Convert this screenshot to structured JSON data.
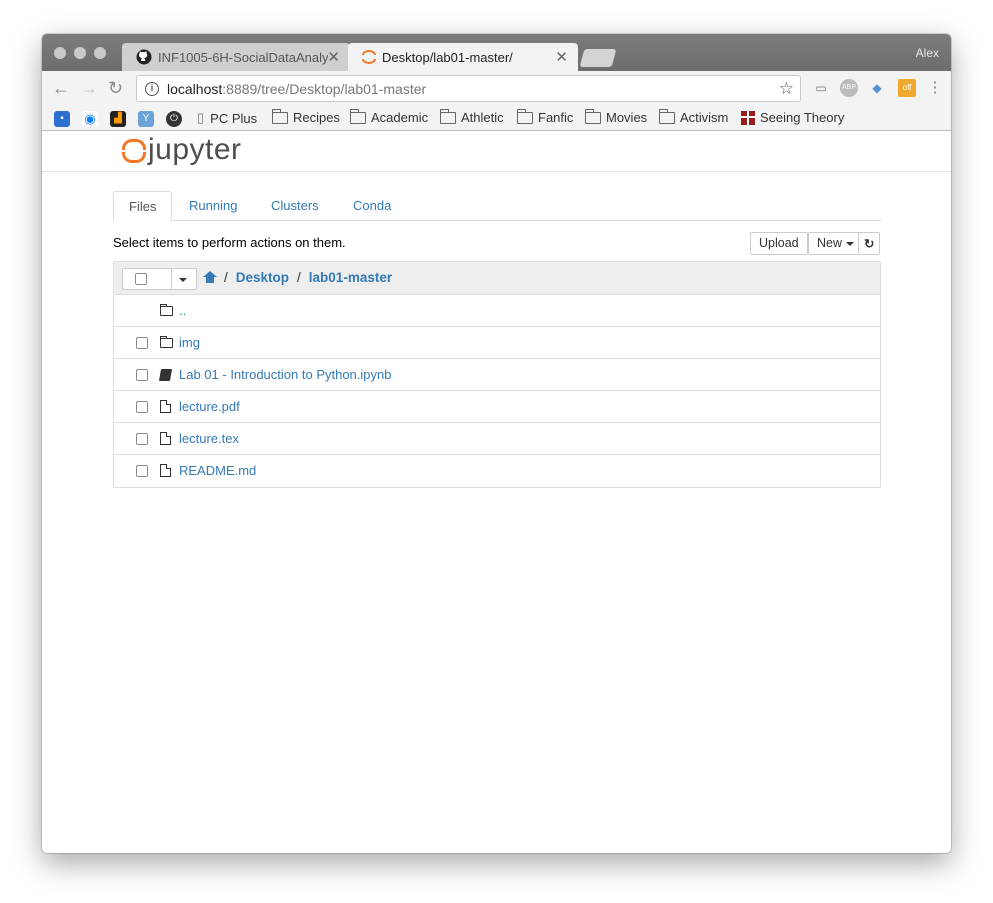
{
  "browser": {
    "tabs": [
      {
        "label": "INF1005-6H-SocialDataAnalyt",
        "active": false
      },
      {
        "label": "Desktop/lab01-master/",
        "active": true
      }
    ],
    "user": "Alex",
    "url_host": "localhost",
    "url_path": ":8889/tree/Desktop/lab01-master",
    "bookmarks": [
      "PC Plus",
      "Recipes",
      "Academic",
      "Athletic",
      "Fanfic",
      "Movies",
      "Activism",
      "Seeing Theory"
    ]
  },
  "jupyter": {
    "logo_text": "jupyter",
    "tabs": [
      "Files",
      "Running",
      "Clusters",
      "Conda"
    ],
    "hint": "Select items to perform actions on them.",
    "upload_label": "Upload",
    "new_label": "New",
    "breadcrumb": [
      "Desktop",
      "lab01-master"
    ],
    "files": [
      {
        "name": "..",
        "type": "folder",
        "checkbox": false
      },
      {
        "name": "img",
        "type": "folder",
        "checkbox": true
      },
      {
        "name": "Lab 01 - Introduction to Python.ipynb",
        "type": "notebook",
        "checkbox": true
      },
      {
        "name": "lecture.pdf",
        "type": "file",
        "checkbox": true
      },
      {
        "name": "lecture.tex",
        "type": "file",
        "checkbox": true
      },
      {
        "name": "README.md",
        "type": "file",
        "checkbox": true
      }
    ]
  },
  "colors": {
    "link": "#337ab7",
    "accent": "#f37726"
  }
}
